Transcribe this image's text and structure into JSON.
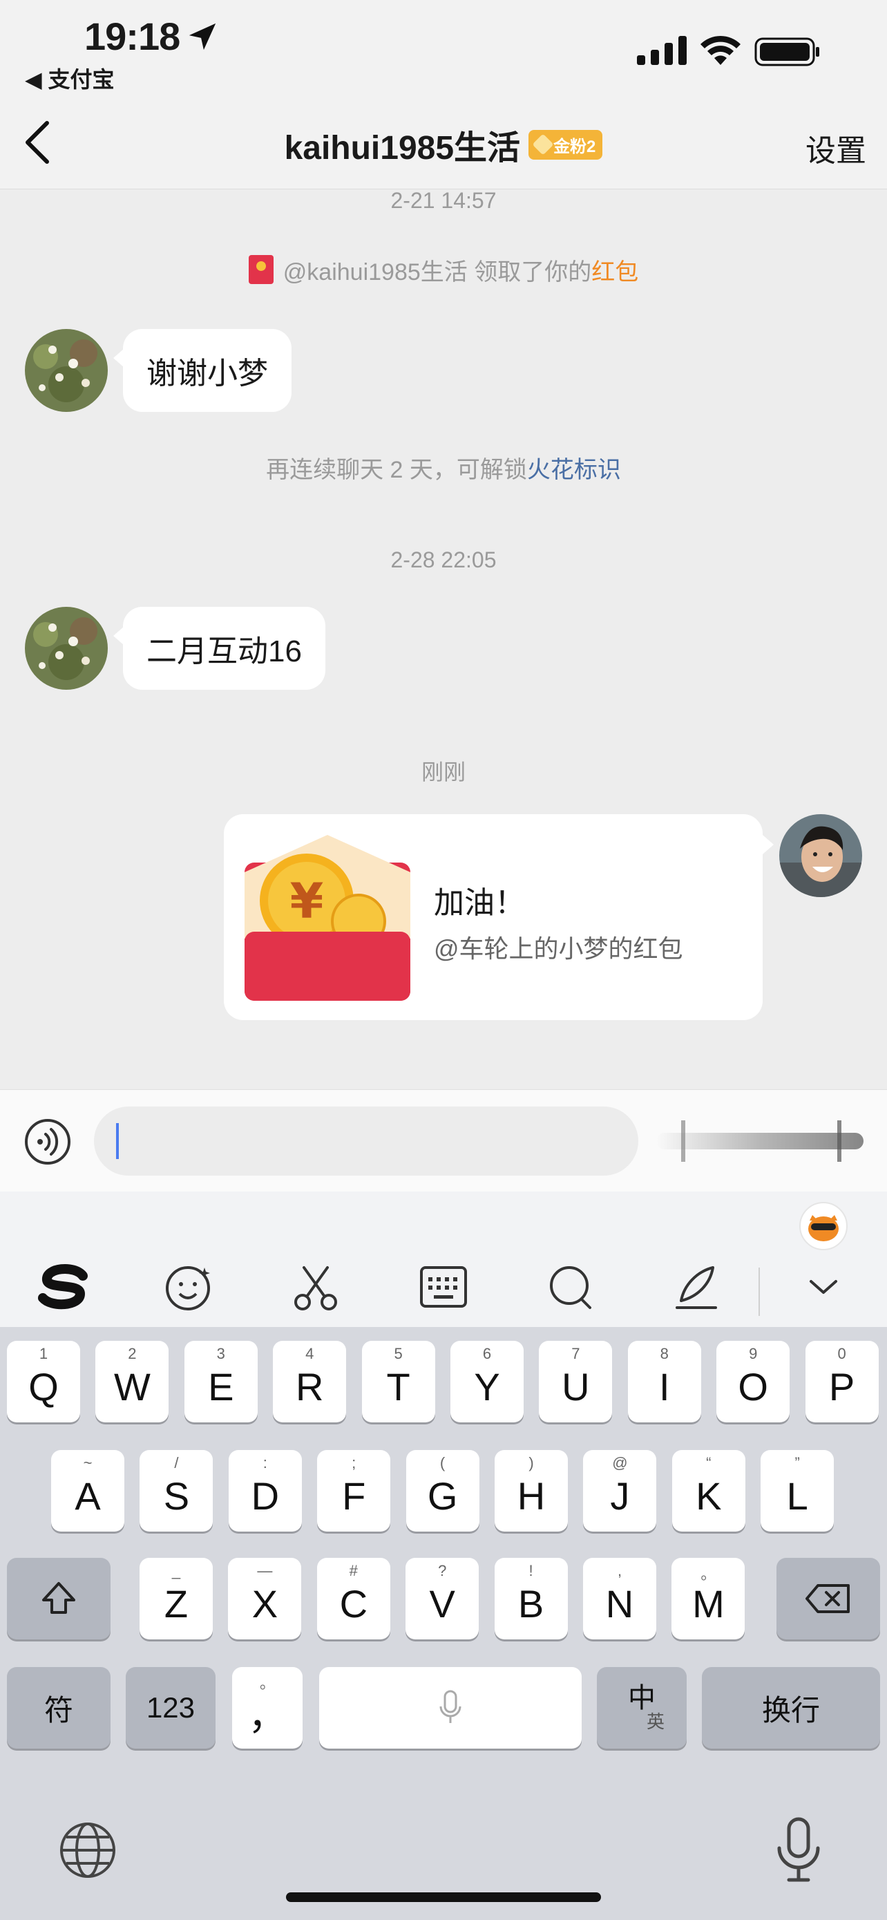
{
  "status": {
    "time": "19:18",
    "back_app": "◀ 支付宝"
  },
  "nav": {
    "title": "kaihui1985生活",
    "badge": "金粉2",
    "settings": "设置"
  },
  "chat": {
    "ts1": "2-21 14:57",
    "redpacket_notice_prefix": "@kaihui1985生活 领取了你的",
    "redpacket_notice_link": "红包",
    "msg1": "谢谢小梦",
    "streak_prefix": "再连续聊天 2 天，可解锁",
    "streak_link": "火花标识",
    "ts2": "2-28 22:05",
    "msg2": "二月互动16",
    "ts3": "刚刚",
    "card_title": "加油！",
    "card_sub": "@车轮上的小梦的红包"
  },
  "input": {
    "placeholder": ""
  },
  "keyboard": {
    "row1": [
      [
        "1",
        "Q"
      ],
      [
        "2",
        "W"
      ],
      [
        "3",
        "E"
      ],
      [
        "4",
        "R"
      ],
      [
        "5",
        "T"
      ],
      [
        "6",
        "Y"
      ],
      [
        "7",
        "U"
      ],
      [
        "8",
        "I"
      ],
      [
        "9",
        "O"
      ],
      [
        "0",
        "P"
      ]
    ],
    "row2": [
      [
        "~",
        "A"
      ],
      [
        "/",
        "S"
      ],
      [
        ":",
        "D"
      ],
      [
        ";",
        "F"
      ],
      [
        "(",
        "G"
      ],
      [
        ")",
        "H"
      ],
      [
        "@",
        "J"
      ],
      [
        "“",
        "K"
      ],
      [
        "”",
        "L"
      ]
    ],
    "row3": [
      [
        "_",
        "Z"
      ],
      [
        "—",
        "X"
      ],
      [
        "#",
        "C"
      ],
      [
        "?",
        "V"
      ],
      [
        "!",
        "B"
      ],
      [
        ",",
        "N"
      ],
      [
        "。",
        "M"
      ]
    ],
    "sym": "符",
    "num": "123",
    "punct": "，",
    "punct_hint": "。",
    "lang_main": "中",
    "lang_sub": "英",
    "enter": "换行"
  },
  "colors": {
    "accent_orange": "#f08a24",
    "link_blue": "#4a6fa5",
    "redpacket_red": "#e2334a"
  }
}
